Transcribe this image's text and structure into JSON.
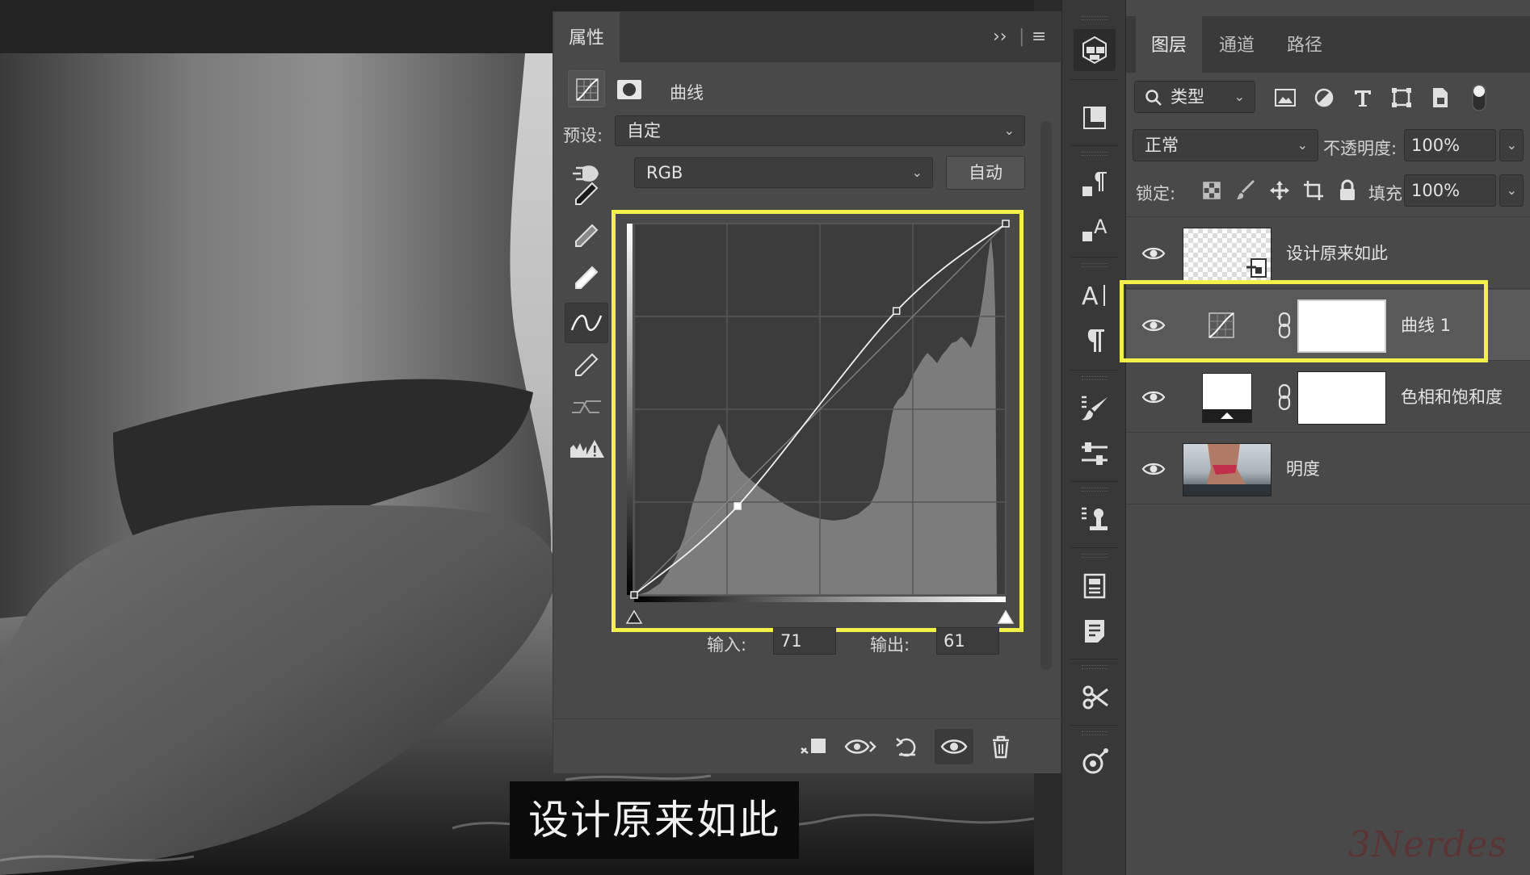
{
  "canvas": {
    "caption": "设计原来如此"
  },
  "properties": {
    "tab_label": "属性",
    "collapse_glyph": "››",
    "menu_glyph": "≡",
    "adjustment_name": "曲线",
    "preset_label": "预设:",
    "preset_value": "自定",
    "channel_value": "RGB",
    "auto_label": "自动",
    "input_label": "输入:",
    "input_value": "71",
    "output_label": "输出:",
    "output_value": "61"
  },
  "curve": {
    "control_points": [
      [
        0,
        0
      ],
      [
        71,
        61
      ],
      [
        180,
        195
      ],
      [
        255,
        255
      ]
    ]
  },
  "layers_panel": {
    "tabs": [
      "图层",
      "通道",
      "路径"
    ],
    "active_tab": 0,
    "filter_label": "类型",
    "blend_mode": "正常",
    "opacity_label": "不透明度:",
    "opacity_value": "100%",
    "lock_label": "锁定:",
    "fill_label": "填充:",
    "fill_value": "100%",
    "layers": [
      {
        "name": "设计原来如此"
      },
      {
        "name": "曲线 1",
        "selected": true
      },
      {
        "name": "色相和饱和度"
      },
      {
        "name": "明度"
      }
    ]
  },
  "watermark": "3Nerdes",
  "colors": {
    "highlight": "#f4f04a",
    "panel_bg": "#494949",
    "toolbar_bg": "#383838"
  }
}
